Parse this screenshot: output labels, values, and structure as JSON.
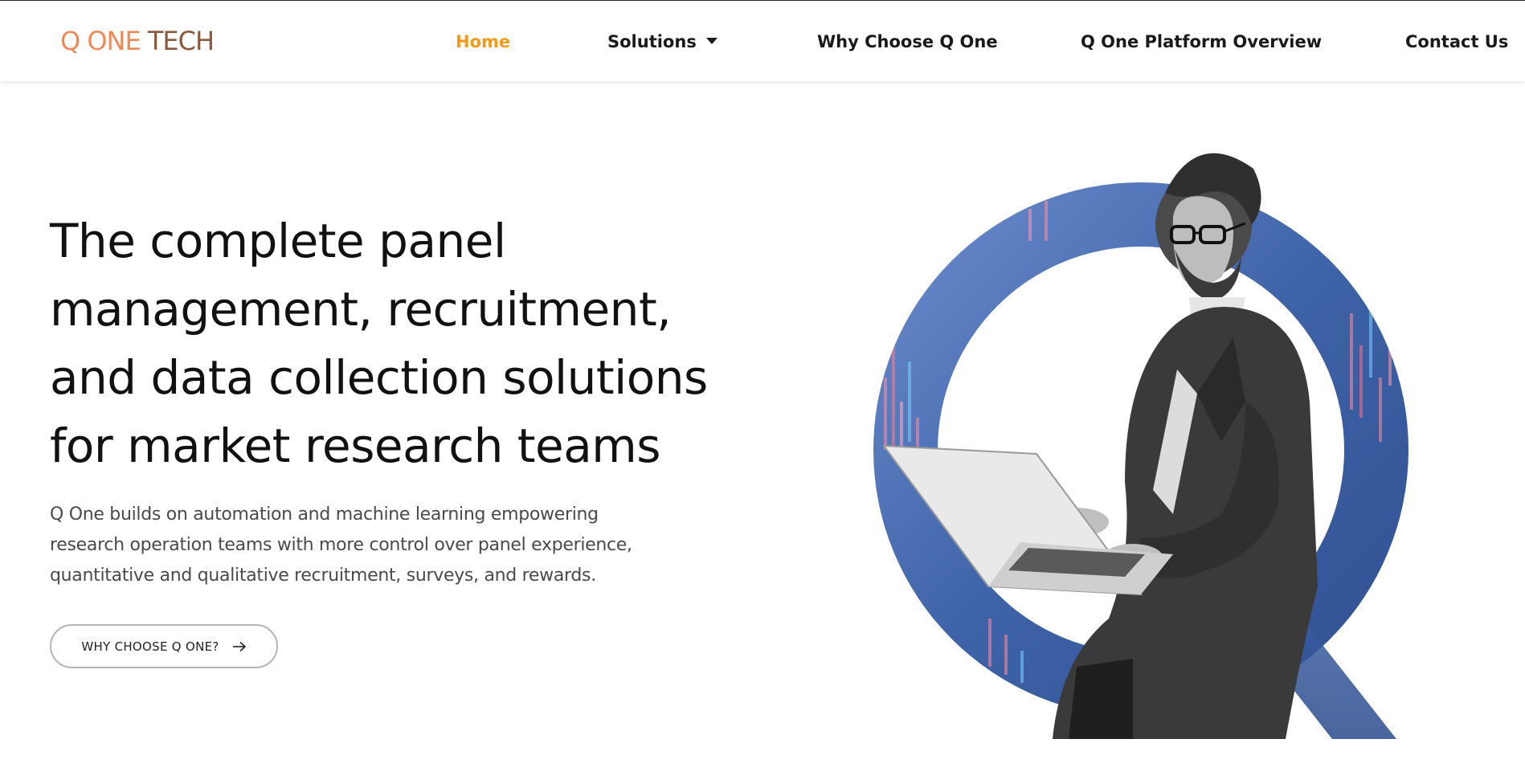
{
  "header": {
    "logo": {
      "q": "Q",
      "one": "ONE",
      "tech": "TECH"
    },
    "nav": [
      {
        "label": "Home",
        "active": true
      },
      {
        "label": "Solutions",
        "has_dropdown": true
      },
      {
        "label": "Why Choose Q One"
      },
      {
        "label": "Q One Platform Overview"
      },
      {
        "label": "Contact Us"
      }
    ]
  },
  "hero": {
    "title_lines": [
      "The complete panel",
      "management, recruitment,",
      "and data collection solutions",
      "for market research teams"
    ],
    "text_lines": [
      "Q One builds on automation and machine learning empowering",
      "research operation teams with more control over panel experience,",
      "quantitative and qualitative recruitment, surveys, and rewards."
    ],
    "cta_label": "WHY CHOOSE Q ONE?",
    "image_icon": "man-with-laptop-q-logo-image"
  },
  "colors": {
    "accent_orange": "#f39a1d",
    "logo_orange": "#ee8a5a",
    "logo_brown": "#8a5a3c",
    "q_blue": "#3f63a8",
    "text_dark": "#111111"
  }
}
